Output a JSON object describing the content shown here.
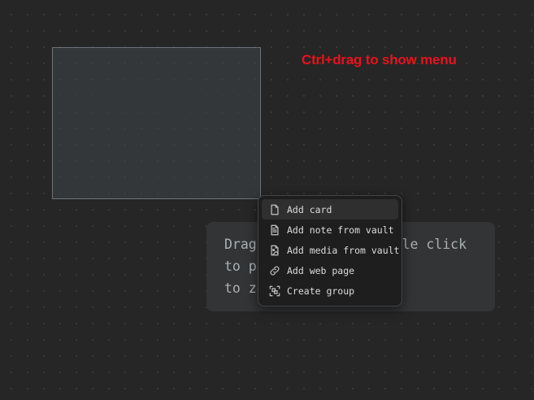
{
  "hint": {
    "text": "Ctrl+drag to show menu",
    "color": "#e8121b"
  },
  "help": {
    "line1": "Drag to add card, double click",
    "line2": "to pan",
    "line3": "to zoom"
  },
  "menu": {
    "items": [
      {
        "label": "Add card",
        "icon": "file-icon"
      },
      {
        "label": "Add note from vault",
        "icon": "file-text-icon"
      },
      {
        "label": "Add media from vault",
        "icon": "file-image-icon"
      },
      {
        "label": "Add web page",
        "icon": "link-icon"
      },
      {
        "label": "Create group",
        "icon": "group-icon"
      }
    ]
  }
}
